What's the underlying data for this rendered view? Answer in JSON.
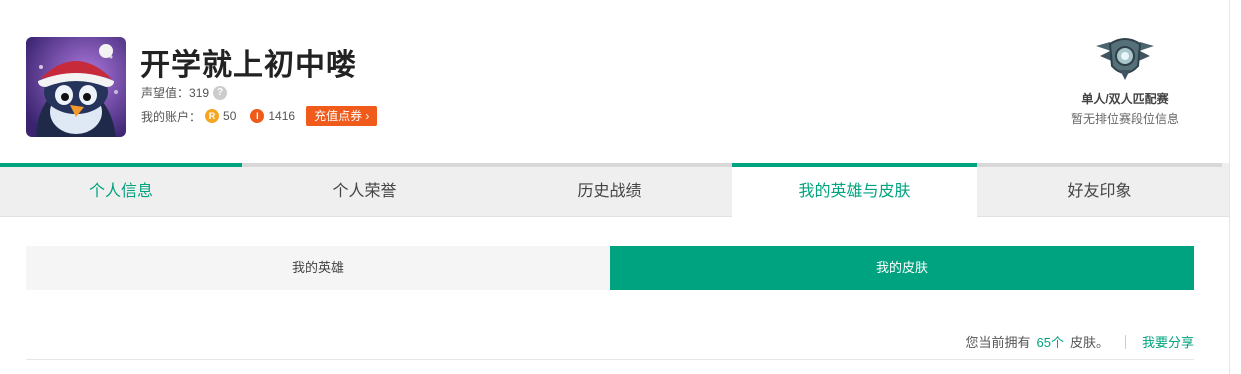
{
  "profile": {
    "name": "开学就上初中喽",
    "reputation_label": "声望值：",
    "reputation_value": "319",
    "help_glyph": "?",
    "account_label": "我的账户：",
    "rp_icon": "R",
    "rp_value": "50",
    "ip_icon": "I",
    "ip_value": "1416",
    "recharge_label": "充值点券 ›"
  },
  "rank": {
    "emblem_icon": "rank-emblem-icon",
    "title": "单人/双人匹配赛",
    "subtitle": "暂无排位赛段位信息"
  },
  "tabs": [
    {
      "label": "个人信息"
    },
    {
      "label": "个人荣誉"
    },
    {
      "label": "历史战绩"
    },
    {
      "label": "我的英雄与皮肤"
    },
    {
      "label": "好友印象"
    }
  ],
  "subtabs": [
    {
      "label": "我的英雄"
    },
    {
      "label": "我的皮肤"
    }
  ],
  "skins": {
    "prefix": "您当前拥有",
    "count": "65个",
    "suffix": "皮肤。",
    "share_label": "我要分享"
  },
  "colors": {
    "accent": "#00a37f",
    "orange": "#f05a1a",
    "gold": "#f5a623"
  }
}
